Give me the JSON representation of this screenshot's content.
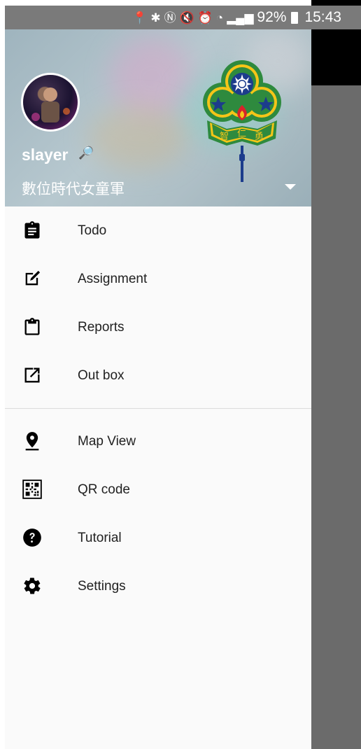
{
  "status_bar": {
    "battery": "92%",
    "time": "15:43"
  },
  "drawer_header": {
    "username": "slayer",
    "organization": "數位時代女童軍",
    "logo_text": [
      "智",
      "仁",
      "勇"
    ]
  },
  "menu": {
    "group1": [
      {
        "label": "Todo",
        "icon": "clipboard-list-icon"
      },
      {
        "label": "Assignment",
        "icon": "edit-square-icon"
      },
      {
        "label": "Reports",
        "icon": "clipboard-icon"
      },
      {
        "label": "Out box",
        "icon": "open-in-new-icon"
      }
    ],
    "group2": [
      {
        "label": "Map View",
        "icon": "map-pin-icon"
      },
      {
        "label": "QR code",
        "icon": "qr-code-icon"
      },
      {
        "label": "Tutorial",
        "icon": "help-circle-icon"
      },
      {
        "label": "Settings",
        "icon": "gear-icon"
      }
    ]
  },
  "colors": {
    "header_bg": "#aebfc6",
    "logo_green": "#2e8a3e",
    "logo_blue": "#1c3c8c",
    "logo_red": "#d8232a",
    "drawer_bg": "#fafafa",
    "scrim": "#6b6b6b"
  }
}
